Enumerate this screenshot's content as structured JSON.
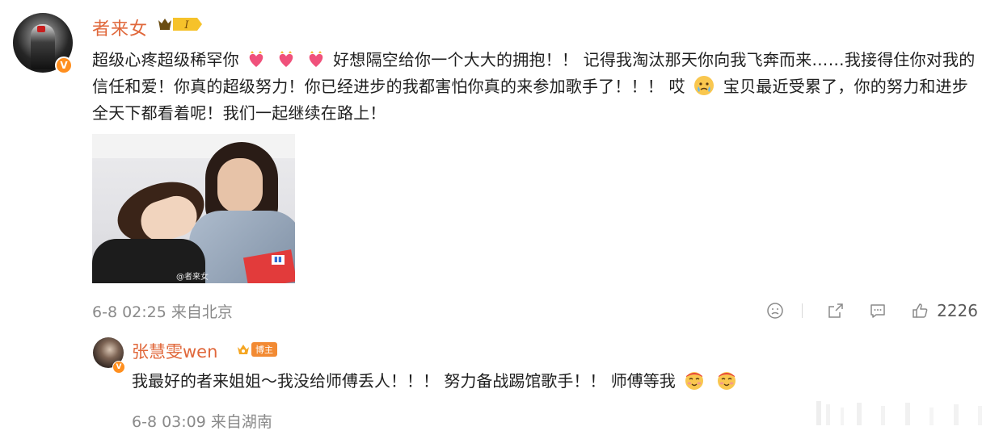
{
  "comment": {
    "username": "者来女",
    "level_badge": "I",
    "text_segments": {
      "t1": "超级心疼超级稀罕你",
      "t2": "好想隔空给你一个大大的拥抱！！ 记得我淘汰那天你向我飞奔而来……我接得住你对我的信任和爱！你真的超级努力！你已经进步的我都害怕你真的来参加歌手了！！！ 哎",
      "t3": "宝贝最近受累了，你的努力和进步全天下都看着呢！我们一起继续在路上！"
    },
    "image_watermark": "@者来女",
    "timestamp": "6-8 02:25",
    "location": "来自北京",
    "like_count": "2226",
    "verify_mark": "V"
  },
  "reply": {
    "username": "张慧雯wen",
    "badge_label": "博主",
    "text": "我最好的者来姐姐～我没给师傅丢人！！！ 努力备战踢馆歌手！！ 师傅等我",
    "timestamp": "6-8 03:09",
    "location": "来自湖南",
    "verify_mark": "V"
  },
  "colors": {
    "username": "#e0673a",
    "verify": "#ff8f1f",
    "meta": "#8a8a8a"
  }
}
